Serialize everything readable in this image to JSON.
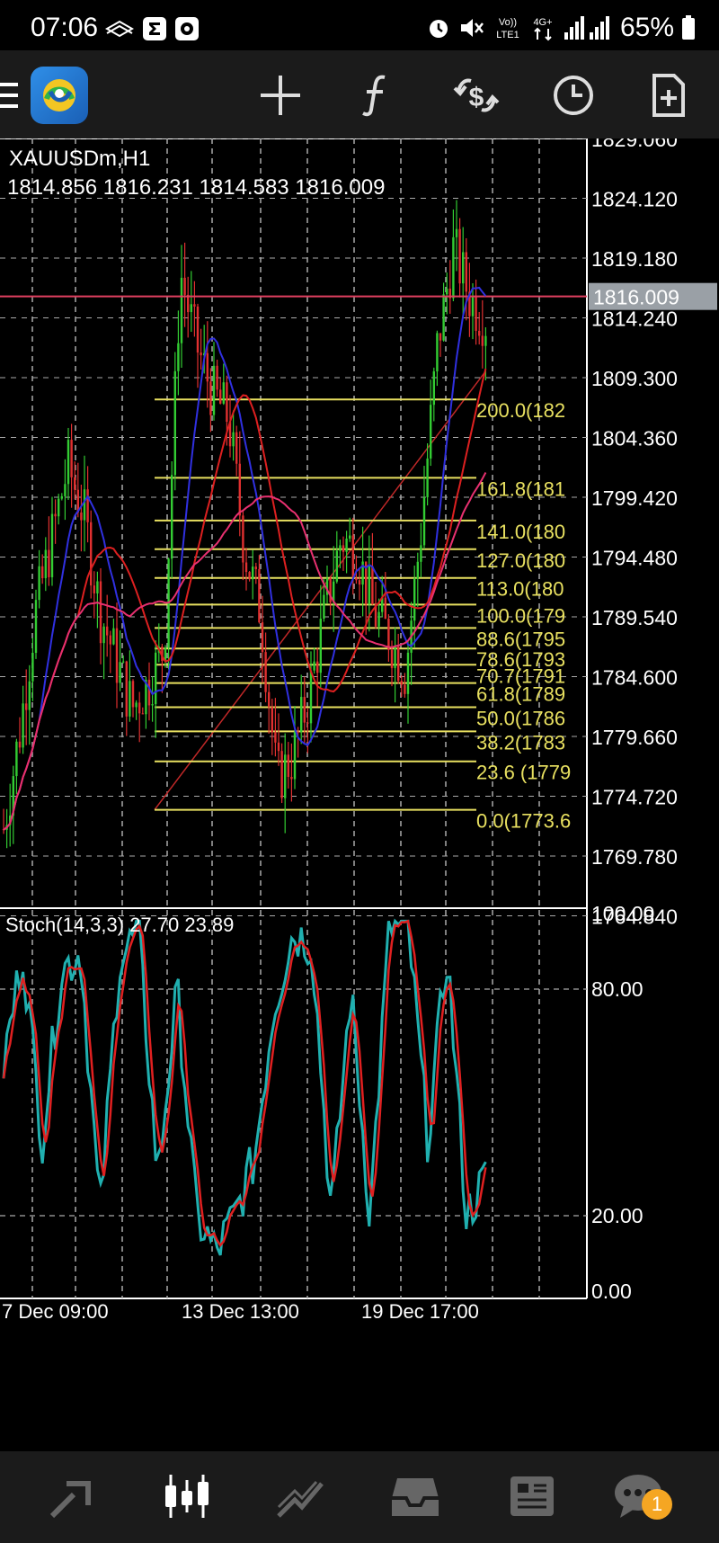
{
  "status_bar": {
    "time": "07:06",
    "network_label": "LTE1",
    "network_gen": "4G+",
    "battery": "65%",
    "icons": [
      "siamgold-icon",
      "sigma-app-icon",
      "square-app-icon",
      "alarm-icon",
      "mute-icon",
      "volte-icon",
      "signal-icon",
      "battery-icon"
    ]
  },
  "toolbar": {
    "icons": [
      "menu-icon",
      "app-logo",
      "crosshair-icon",
      "indicators-f-icon",
      "trade-dollar-icon",
      "clock-period-icon",
      "new-document-icon"
    ]
  },
  "chart": {
    "symbol_label": "XAUUSDm,H1",
    "ohlc_label": "1814.856 1816.231 1814.583 1816.009",
    "current_price": "1816.009",
    "price_ticks": [
      "1829.060",
      "1824.120",
      "1819.180",
      "1814.240",
      "1809.300",
      "1804.360",
      "1799.420",
      "1794.480",
      "1789.540",
      "1784.600",
      "1779.660",
      "1774.720",
      "1769.780",
      "1764.840"
    ],
    "fib_labels": [
      "200.0(182",
      "161.8(181",
      "141.0(180",
      "127.0(180",
      "113.0(180",
      "100.0(179",
      "88.6(1795",
      "78.6(1793",
      "70.7(1791",
      "61.8(1789",
      "50.0(1786",
      "38.2(1783",
      "23.6 (1779",
      "0.0(1773.6"
    ],
    "colors": {
      "bull": "#33cc33",
      "bear": "#e03030",
      "fib": "#e8e060",
      "ma_blue": "#3030e0",
      "ma_red": "#dd2020",
      "ma_pink": "#e83070",
      "price_line": "#e04060",
      "stoch_main": "#20b0b0",
      "stoch_signal": "#e02020"
    }
  },
  "stoch": {
    "label": "Stoch(14,3,3) 27.70 23.89",
    "ticks": [
      "100.00",
      "80.00",
      "20.00",
      "0.00"
    ]
  },
  "time_axis": [
    "7 Dec 09:00",
    "13 Dec 13:00",
    "19 Dec 17:00"
  ],
  "bottom_nav": {
    "items": [
      "quotes-icon",
      "chart-icon",
      "trade-icon",
      "history-icon",
      "news-icon",
      "messages-icon"
    ],
    "active": "chart-icon",
    "badge": "1"
  }
}
